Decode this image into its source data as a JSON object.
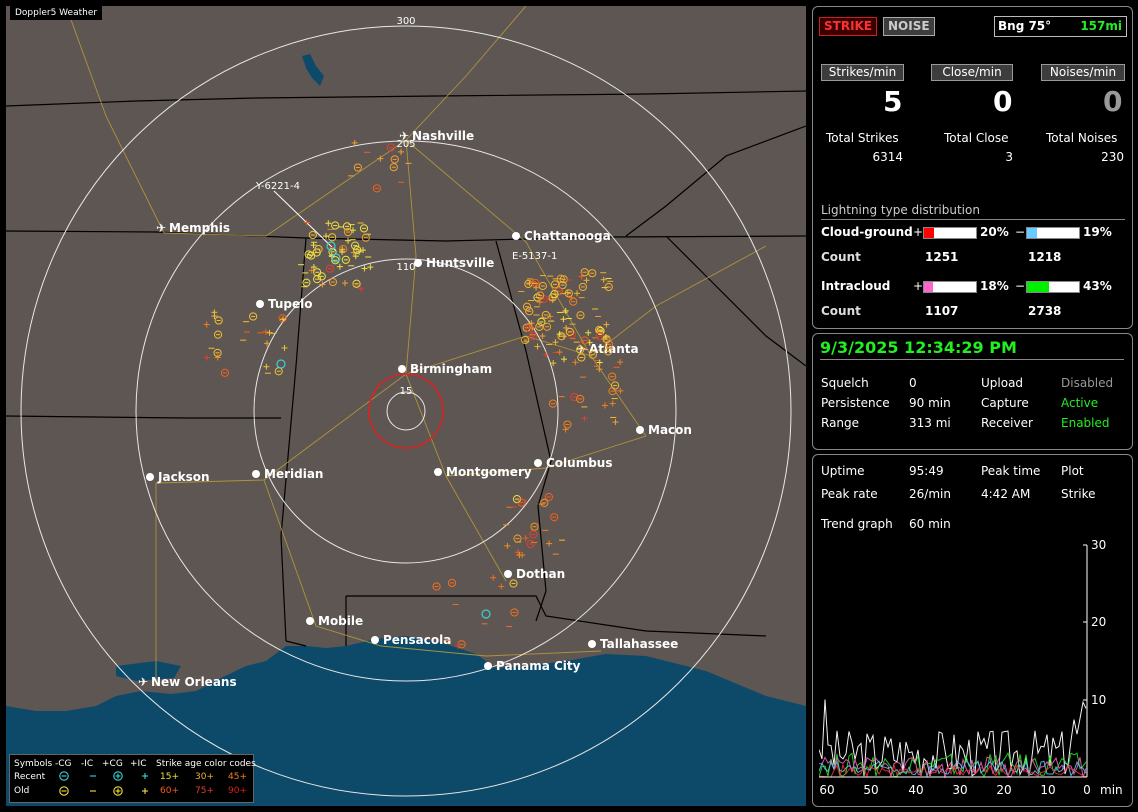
{
  "map": {
    "title": "Doppler5 Weather",
    "ring_labels": [
      "300",
      "205",
      "110",
      "15"
    ],
    "cities": [
      {
        "name": "Nashville",
        "airport": true
      },
      {
        "name": "Memphis",
        "airport": true
      },
      {
        "name": "Chattanooga",
        "airport": false
      },
      {
        "name": "Huntsville",
        "airport": false
      },
      {
        "name": "Tupelo",
        "airport": false
      },
      {
        "name": "Birmingham",
        "airport": false
      },
      {
        "name": "Atlanta",
        "airport": true
      },
      {
        "name": "Macon",
        "airport": false
      },
      {
        "name": "Jackson",
        "airport": false
      },
      {
        "name": "Meridian",
        "airport": false
      },
      {
        "name": "Montgomery",
        "airport": false
      },
      {
        "name": "Columbus",
        "airport": false
      },
      {
        "name": "Dothan",
        "airport": false
      },
      {
        "name": "Mobile",
        "airport": false
      },
      {
        "name": "Pensacola",
        "airport": false
      },
      {
        "name": "Tallahassee",
        "airport": false
      },
      {
        "name": "Panama City",
        "airport": false
      },
      {
        "name": "New Orleans",
        "airport": true
      }
    ],
    "storm_labels": [
      "Y-6221-4",
      "E-5137-1"
    ],
    "legend": {
      "symbols_label": "Symbols",
      "recent_label": "Recent",
      "old_label": "Old",
      "col_headers": [
        "-CG",
        "-IC",
        "+CG",
        "+IC"
      ],
      "age_title": "Strike age color codes",
      "recent_ages": [
        "15+",
        "30+",
        "45+"
      ],
      "old_ages": [
        "60+",
        "75+",
        "90+"
      ]
    }
  },
  "status": {
    "strike_label": "STRIKE",
    "noise_label": "NOISE",
    "bearing_label": "Bng 75°",
    "distance": "157mi"
  },
  "rates": {
    "strikes_label": "Strikes/min",
    "strikes_value": "5",
    "close_label": "Close/min",
    "close_value": "0",
    "noises_label": "Noises/min",
    "noises_value": "0"
  },
  "totals": {
    "strikes_label": "Total Strikes",
    "strikes_value": "6314",
    "close_label": "Total Close",
    "close_value": "3",
    "noises_label": "Total Noises",
    "noises_value": "230"
  },
  "distribution": {
    "title": "Lightning type distribution",
    "cg_label": "Cloud-ground",
    "ic_label": "Intracloud",
    "count_label": "Count",
    "plus": "+",
    "minus": "−",
    "cg_pos_pct": "20%",
    "cg_neg_pct": "19%",
    "cg_pos_count": "1251",
    "cg_neg_count": "1218",
    "ic_pos_pct": "18%",
    "ic_neg_pct": "43%",
    "ic_pos_count": "1107",
    "ic_neg_count": "2738",
    "fractions": {
      "cg_pos": 0.2,
      "cg_neg": 0.19,
      "ic_pos": 0.18,
      "ic_neg": 0.43
    },
    "colors": {
      "cg_pos": "#ff0000",
      "cg_neg": "#66ccff",
      "ic_pos": "#ff66cc",
      "ic_neg": "#00ee00"
    }
  },
  "settings": {
    "datetime": "9/3/2025 12:34:29 PM",
    "squelch_label": "Squelch",
    "squelch_value": "0",
    "persistence_label": "Persistence",
    "persistence_value": "90 min",
    "range_label": "Range",
    "range_value": "313 mi",
    "upload_label": "Upload",
    "upload_value": "Disabled",
    "capture_label": "Capture",
    "capture_value": "Active",
    "receiver_label": "Receiver",
    "receiver_value": "Enabled"
  },
  "trend": {
    "uptime_label": "Uptime",
    "uptime_value": "95:49",
    "peak_time_label": "Peak time",
    "peak_time_value": "4:42 AM",
    "plot_label": "Plot",
    "plot_value": "Strike",
    "peak_rate_label": "Peak rate",
    "peak_rate_value": "26/min",
    "graph_label": "Trend graph",
    "graph_value": "60 min",
    "y_ticks": [
      "30",
      "20",
      "10"
    ],
    "x_ticks": [
      "60",
      "50",
      "40",
      "30",
      "20",
      "10",
      "0"
    ],
    "x_unit": "min"
  }
}
